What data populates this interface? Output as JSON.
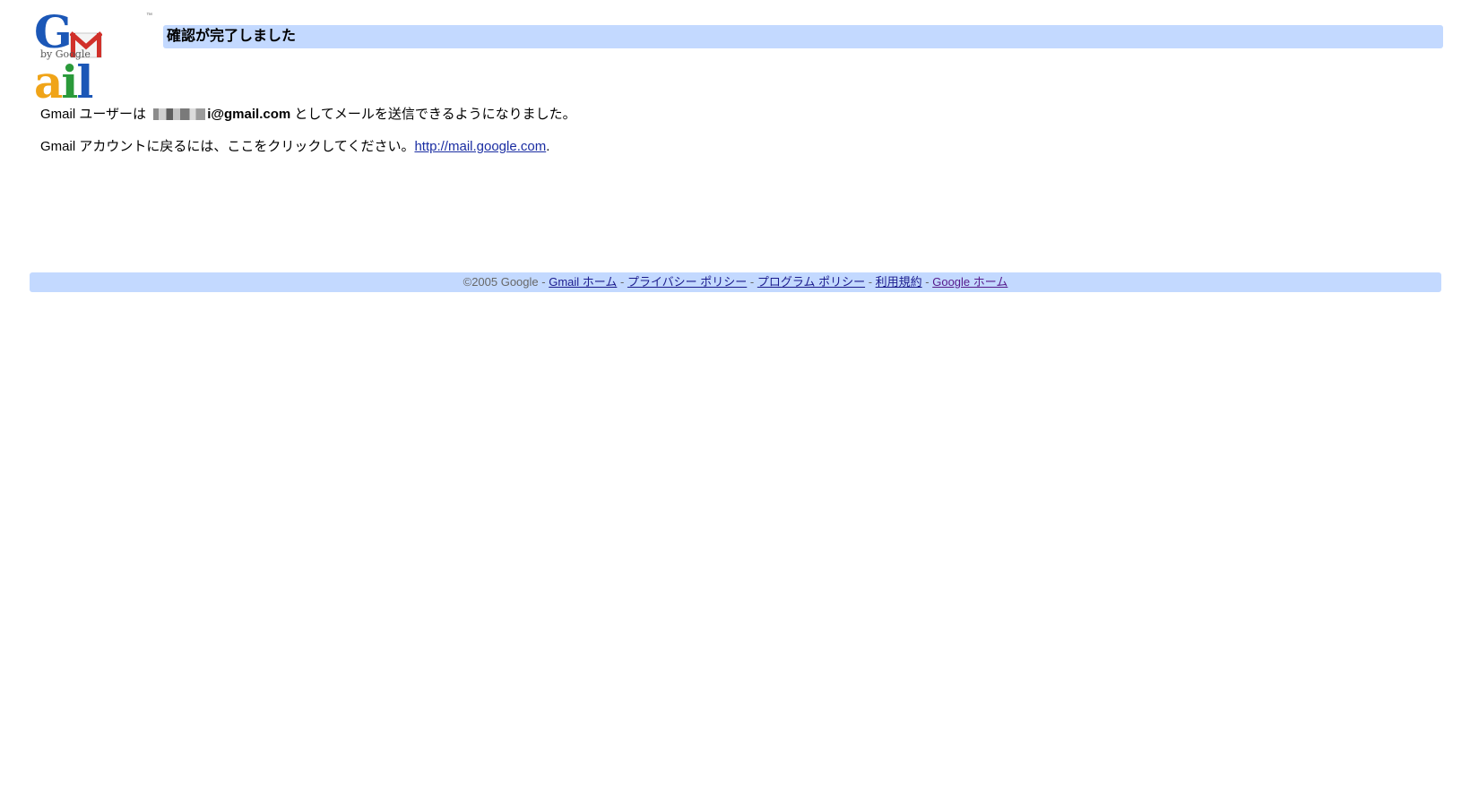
{
  "logo": {
    "letters": [
      "G",
      "a",
      "i",
      "l"
    ],
    "byline": "by Google",
    "trademark": "™",
    "colors": {
      "g": "#1b57b7",
      "m_red": "#d1302a",
      "a": "#f0a418",
      "l": "#2a9a3a"
    }
  },
  "header": {
    "title": "確認が完了しました",
    "bar_color": "#c3d9ff"
  },
  "content": {
    "line1_prefix": "Gmail ユーザーは ",
    "line1_email": "i@gmail.com",
    "line1_suffix": " としてメールを送信できるようになりました。",
    "line2_prefix": "Gmail アカウントに戻るには、ここをクリックしてください。",
    "line2_link": "http://mail.google.com",
    "line2_suffix": "."
  },
  "footer": {
    "copyright": "©2005 Google",
    "separator": " - ",
    "links": [
      {
        "label": "Gmail ホーム"
      },
      {
        "label": "プライバシー ポリシー"
      },
      {
        "label": "プログラム ポリシー"
      },
      {
        "label": "利用規約"
      },
      {
        "label": "Google ホーム"
      }
    ]
  }
}
